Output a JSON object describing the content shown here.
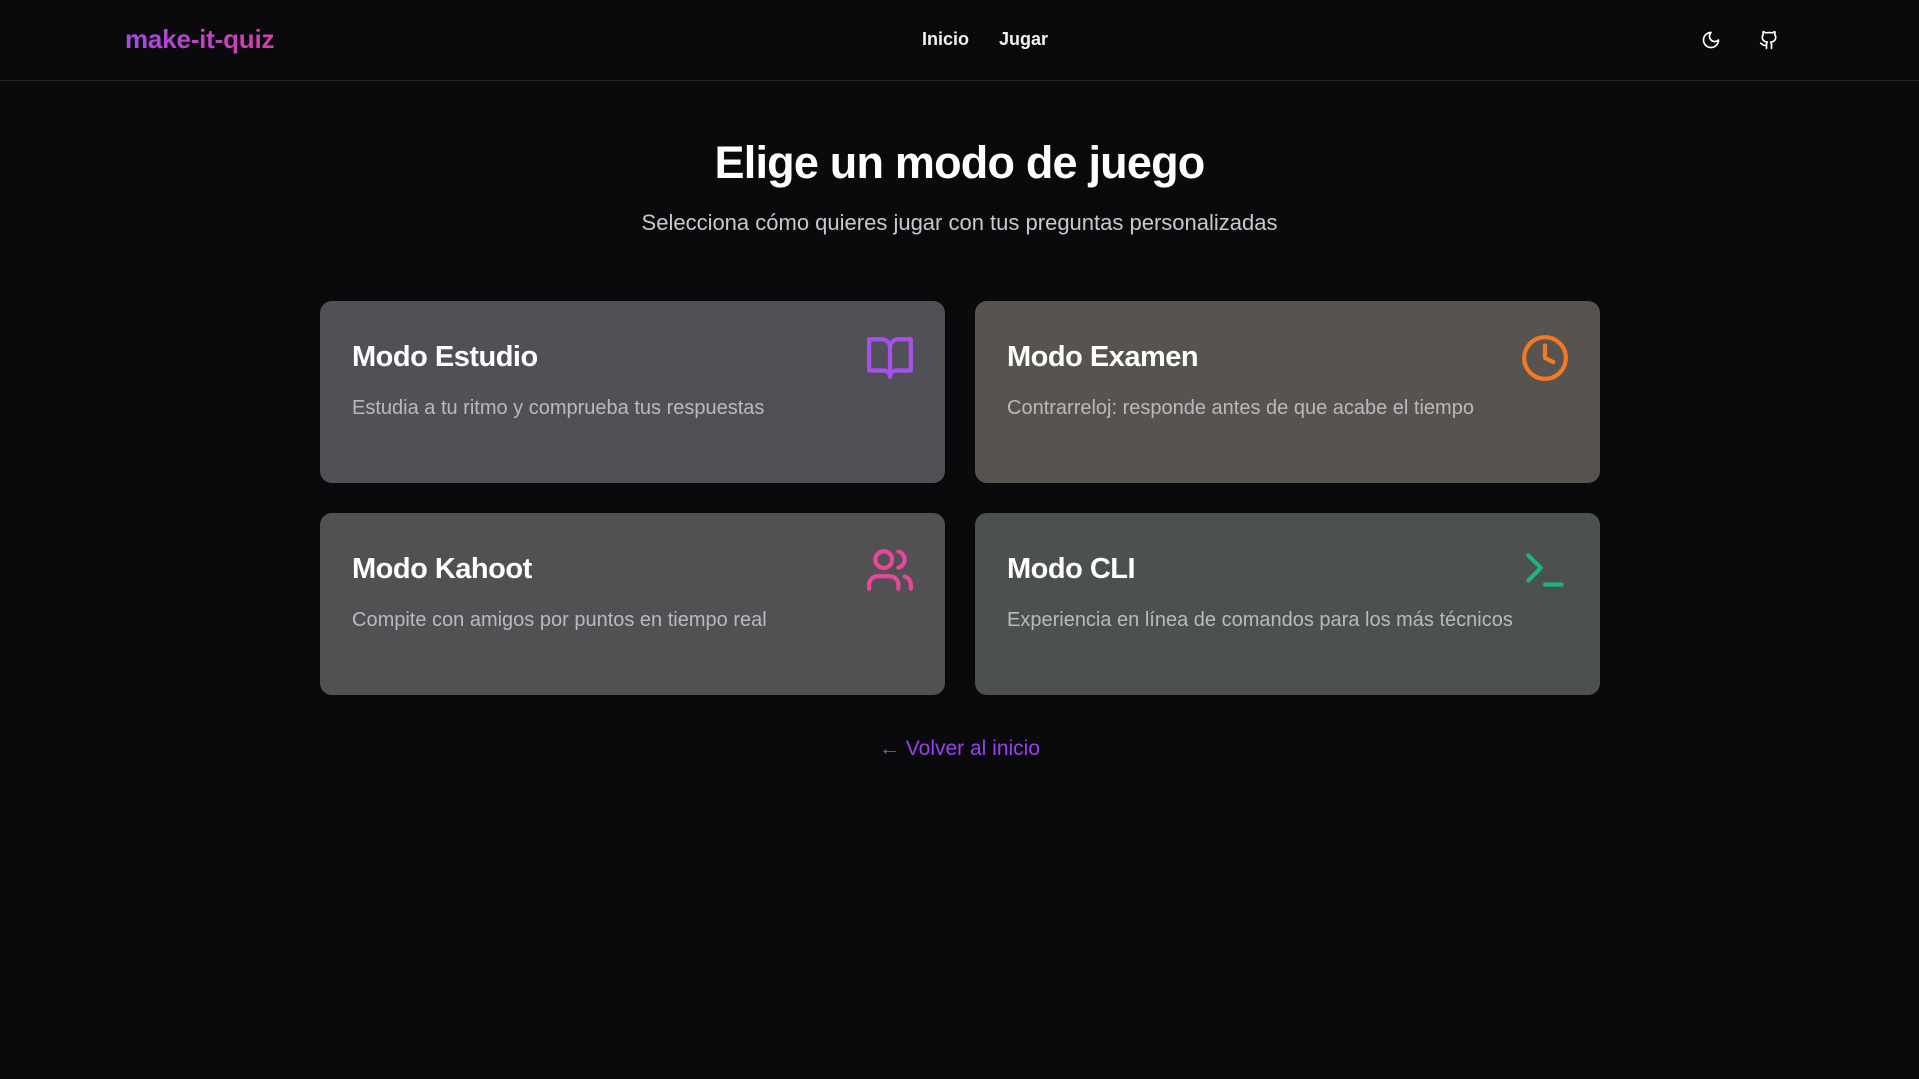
{
  "header": {
    "brand": "make-it-quiz",
    "nav": [
      {
        "label": "Inicio"
      },
      {
        "label": "Jugar"
      }
    ],
    "icons": {
      "theme": "moon-icon",
      "github": "github-icon"
    }
  },
  "main": {
    "title": "Elige un modo de juego",
    "subtitle": "Selecciona cómo quieres jugar con tus preguntas personalizadas",
    "modes": [
      {
        "title": "Modo Estudio",
        "description": "Estudia a tu ritmo y comprueba tus respuestas",
        "icon": "book-open-icon",
        "accent": "#a84ff0"
      },
      {
        "title": "Modo Examen",
        "description": "Contrarreloj: responde antes de que acabe el tiempo",
        "icon": "clock-icon",
        "accent": "#f27a22"
      },
      {
        "title": "Modo Kahoot",
        "description": "Compite con amigos por puntos en tiempo real",
        "icon": "users-icon",
        "accent": "#e8479a"
      },
      {
        "title": "Modo CLI",
        "description": "Experiencia en línea de comandos para los más técnicos",
        "icon": "terminal-icon",
        "accent": "#19b584"
      }
    ],
    "back_link": "← Volver al inicio"
  },
  "colors": {
    "background": "#0a0a0c",
    "link": "#9b3ff0"
  }
}
